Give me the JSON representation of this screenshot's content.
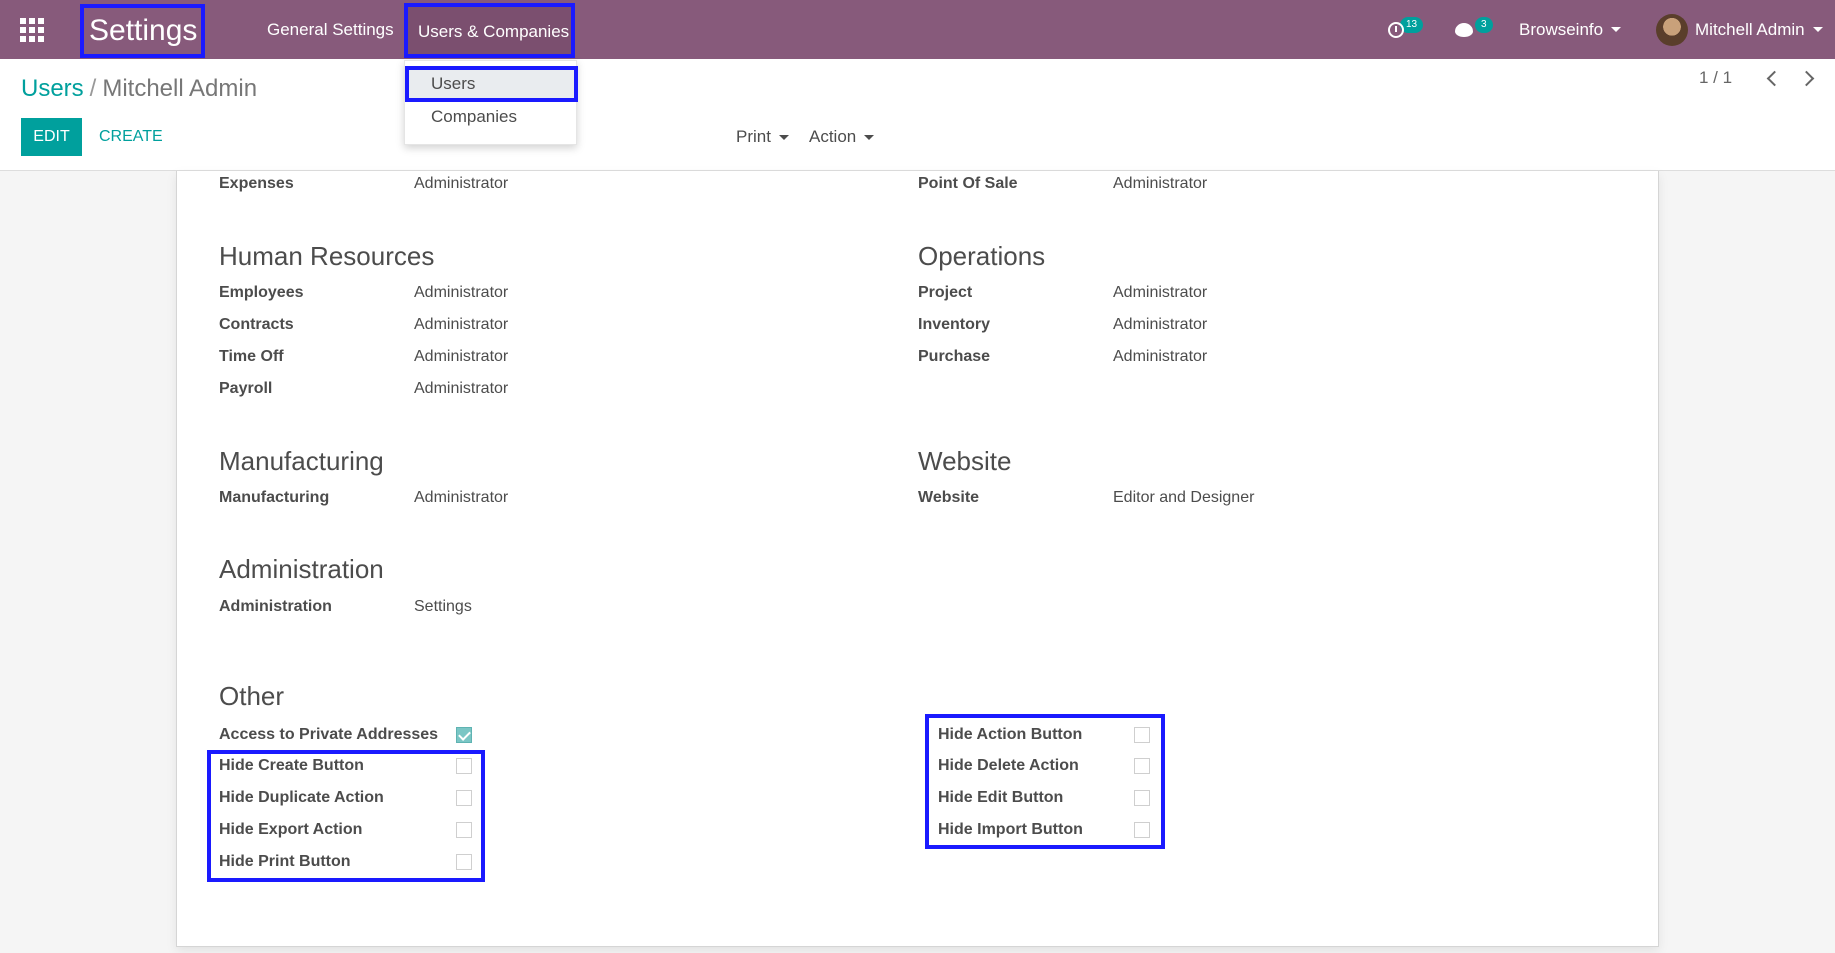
{
  "navbar": {
    "brand": "Settings",
    "menu": {
      "general": "General Settings",
      "users_companies": "Users & Companies"
    },
    "activity_count": "13",
    "messages_count": "3",
    "company": "Browseinfo",
    "user": "Mitchell Admin",
    "bg_color": "#875a7b"
  },
  "dropdown": {
    "users": "Users",
    "companies": "Companies"
  },
  "breadcrumb": {
    "parent": "Users",
    "separator": "/",
    "current": "Mitchell Admin"
  },
  "buttons": {
    "edit": "EDIT",
    "create": "CREATE",
    "print": "Print",
    "action": "Action"
  },
  "pager": {
    "value": "1 / 1"
  },
  "accent_color": "#00a09d",
  "highlight_color": "#1a1aff",
  "groups_left": {
    "top_row": {
      "label": "Expenses",
      "value": "Administrator"
    },
    "hr": {
      "title": "Human Resources",
      "rows": [
        {
          "label": "Employees",
          "value": "Administrator"
        },
        {
          "label": "Contracts",
          "value": "Administrator"
        },
        {
          "label": "Time Off",
          "value": "Administrator"
        },
        {
          "label": "Payroll",
          "value": "Administrator"
        }
      ]
    },
    "manufacturing": {
      "title": "Manufacturing",
      "rows": [
        {
          "label": "Manufacturing",
          "value": "Administrator"
        }
      ]
    },
    "administration": {
      "title": "Administration",
      "rows": [
        {
          "label": "Administration",
          "value": "Settings"
        }
      ]
    }
  },
  "groups_right": {
    "top_row": {
      "label": "Point Of Sale",
      "value": "Administrator"
    },
    "operations": {
      "title": "Operations",
      "rows": [
        {
          "label": "Project",
          "value": "Administrator"
        },
        {
          "label": "Inventory",
          "value": "Administrator"
        },
        {
          "label": "Purchase",
          "value": "Administrator"
        }
      ]
    },
    "website": {
      "title": "Website",
      "rows": [
        {
          "label": "Website",
          "value": "Editor and Designer"
        }
      ]
    }
  },
  "other": {
    "title": "Other",
    "left": [
      {
        "label": "Access to Private Addresses",
        "checked": true
      },
      {
        "label": "Hide Create Button",
        "checked": false
      },
      {
        "label": "Hide Duplicate Action",
        "checked": false
      },
      {
        "label": "Hide Export Action",
        "checked": false
      },
      {
        "label": "Hide Print Button",
        "checked": false
      }
    ],
    "right": [
      {
        "label": "Hide Action Button",
        "checked": false
      },
      {
        "label": "Hide Delete Action",
        "checked": false
      },
      {
        "label": "Hide Edit Button",
        "checked": false
      },
      {
        "label": "Hide Import Button",
        "checked": false
      }
    ]
  }
}
